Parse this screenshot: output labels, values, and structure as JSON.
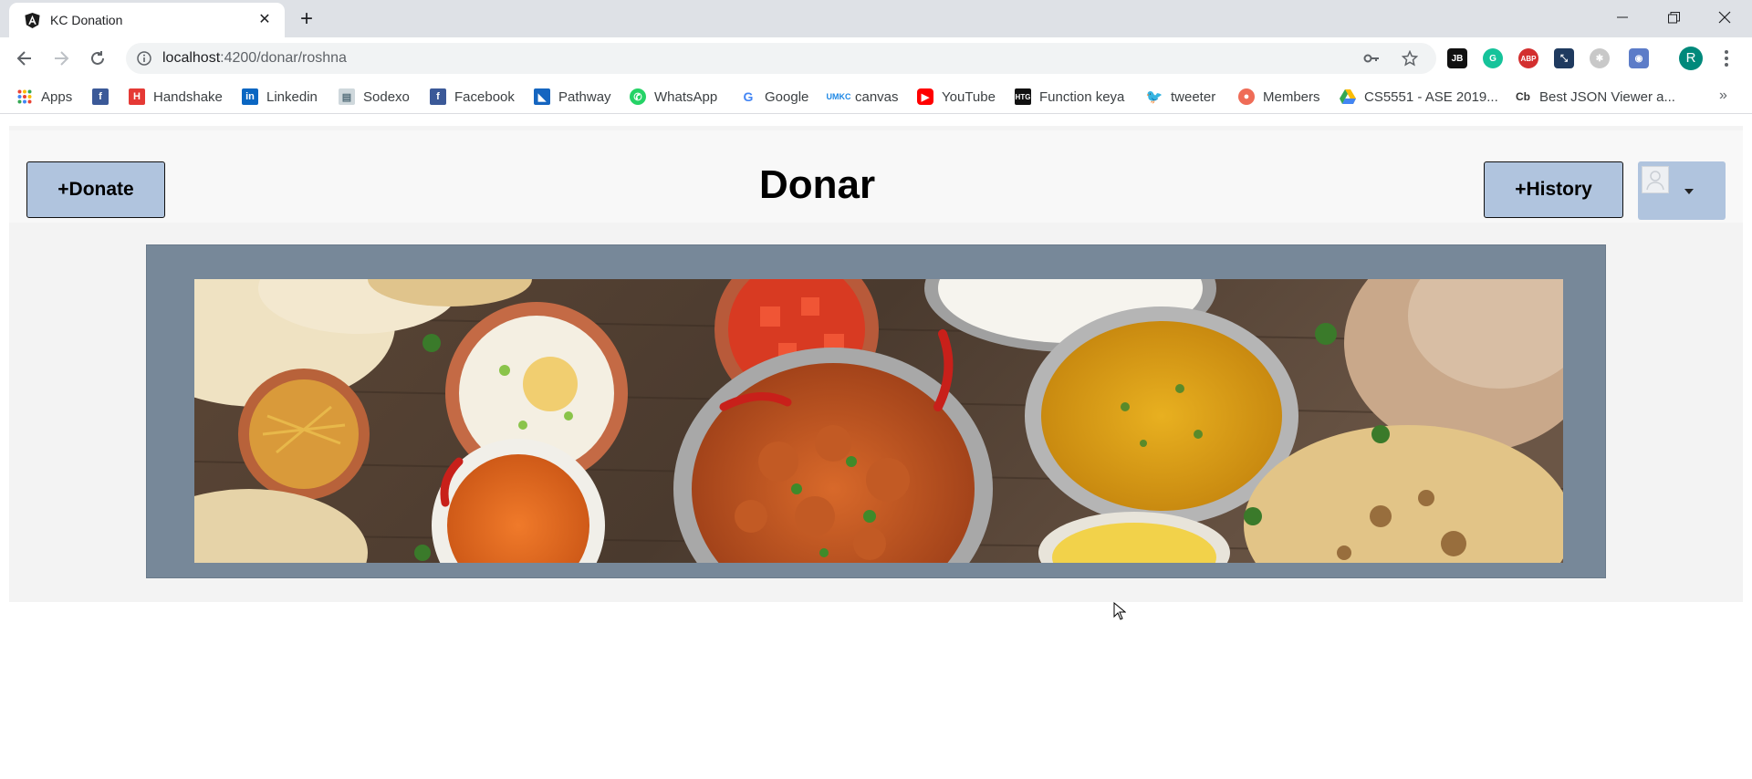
{
  "browser": {
    "tab_title": "KC Donation",
    "url_host": "localhost",
    "url_path": ":4200/donar/roshna",
    "profile_initial": "R",
    "bookmarks": [
      {
        "label": "Apps",
        "icon": "apps-grid-icon",
        "color": "#4285f4"
      },
      {
        "label": "",
        "icon": "facebook-icon",
        "color": "#3b5998"
      },
      {
        "label": "Handshake",
        "icon": "handshake-icon",
        "color": "#e53935"
      },
      {
        "label": "Linkedin",
        "icon": "linkedin-icon",
        "color": "#0a66c2"
      },
      {
        "label": "Sodexo",
        "icon": "sodexo-icon",
        "color": "#9e9e9e"
      },
      {
        "label": "Facebook",
        "icon": "facebook-icon",
        "color": "#3b5998"
      },
      {
        "label": "Pathway",
        "icon": "pathway-icon",
        "color": "#1565c0"
      },
      {
        "label": "WhatsApp",
        "icon": "whatsapp-icon",
        "color": "#25d366"
      },
      {
        "label": "Google",
        "icon": "google-icon",
        "color": "#4285f4"
      },
      {
        "label": "canvas",
        "icon": "umkc-icon",
        "color": "#1e88e5"
      },
      {
        "label": "YouTube",
        "icon": "youtube-icon",
        "color": "#ff0000"
      },
      {
        "label": "Function keya",
        "icon": "htg-icon",
        "color": "#111111"
      },
      {
        "label": "tweeter",
        "icon": "twitter-icon",
        "color": "#1da1f2"
      },
      {
        "label": "Members",
        "icon": "members-icon",
        "color": "#ef6c57"
      },
      {
        "label": "CS5551 - ASE 2019...",
        "icon": "google-drive-icon",
        "color": "#fbbc04"
      },
      {
        "label": "Best JSON Viewer a...",
        "icon": "cb-icon",
        "color": "#333333"
      }
    ],
    "more_bookmarks": "»"
  },
  "page": {
    "title": "Donar",
    "donate_label": "+Donate",
    "history_label": "+History",
    "banner_image": "indian-food-spread-image"
  },
  "colors": {
    "button_bg": "#b0c4de",
    "frame_bg": "#778899",
    "page_bg": "#f3f3f3"
  }
}
